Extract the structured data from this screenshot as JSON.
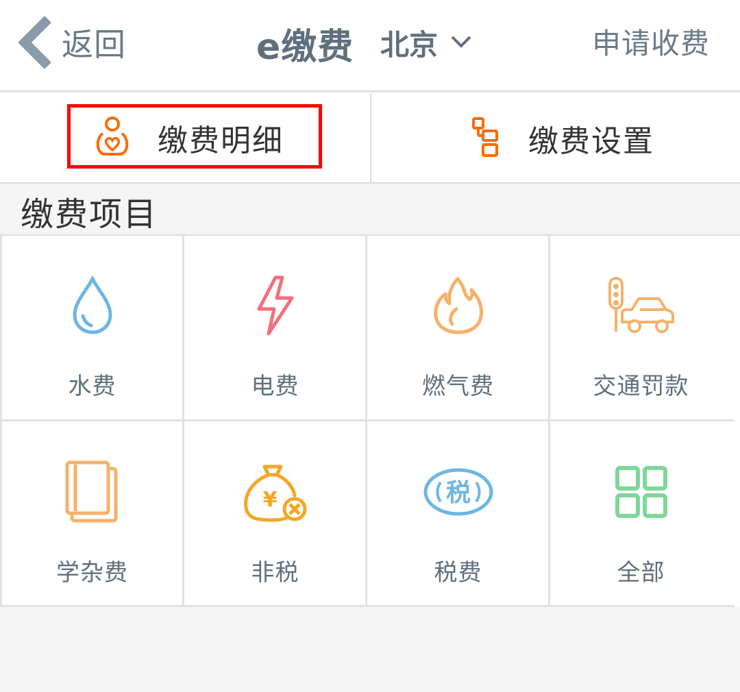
{
  "header": {
    "back_label": "返回",
    "title": "e缴费",
    "city": "北京",
    "apply_label": "申请收费"
  },
  "tabs": [
    {
      "label": "缴费明细",
      "icon": "mother-baby-icon",
      "highlighted": true
    },
    {
      "label": "缴费设置",
      "icon": "settings-nodes-icon",
      "highlighted": false
    }
  ],
  "section": {
    "title": "缴费项目"
  },
  "items": [
    {
      "label": "水费",
      "icon": "water-drop-icon"
    },
    {
      "label": "电费",
      "icon": "lightning-icon"
    },
    {
      "label": "燃气费",
      "icon": "flame-icon"
    },
    {
      "label": "交通罚款",
      "icon": "traffic-car-icon"
    },
    {
      "label": "学杂费",
      "icon": "book-icon"
    },
    {
      "label": "非税",
      "icon": "money-bag-icon"
    },
    {
      "label": "税费",
      "icon": "tax-badge-icon",
      "badge_text": "税"
    },
    {
      "label": "全部",
      "icon": "grid-icon"
    }
  ],
  "colors": {
    "header_text": "#5f6f7d",
    "tab_icon_orange": "#ff6a00",
    "highlight": "#ff0000",
    "water": "#6db6e3",
    "electric": "#f2707a",
    "gas": "#f6b16a",
    "traffic": "#f6b16a",
    "book": "#f6b16a",
    "nontax": "#f5a623",
    "tax": "#6db6e3",
    "all": "#7ed79a"
  }
}
